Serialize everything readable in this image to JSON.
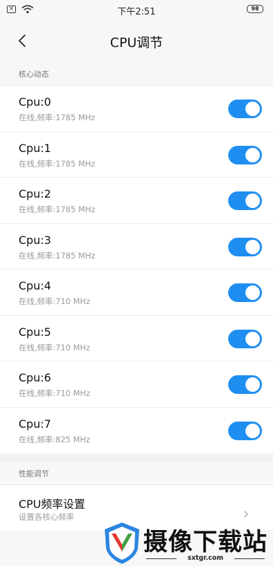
{
  "status_bar": {
    "time": "下午2:51",
    "battery": "98",
    "left_icons": [
      "sim-x-icon",
      "wifi-icon"
    ]
  },
  "header": {
    "title": "CPU调节",
    "back_icon": "chevron-left-icon"
  },
  "sections": {
    "core_state": {
      "label": "核心动态"
    },
    "perf": {
      "label": "性能调节"
    }
  },
  "cores": [
    {
      "title": "Cpu:0",
      "subtitle": "在线,频率:1785 MHz",
      "enabled": true
    },
    {
      "title": "Cpu:1",
      "subtitle": "在线,频率:1785 MHz",
      "enabled": true
    },
    {
      "title": "Cpu:2",
      "subtitle": "在线,频率:1785 MHz",
      "enabled": true
    },
    {
      "title": "Cpu:3",
      "subtitle": "在线,频率:1785 MHz",
      "enabled": true
    },
    {
      "title": "Cpu:4",
      "subtitle": "在线,频率:710 MHz",
      "enabled": true
    },
    {
      "title": "Cpu:5",
      "subtitle": "在线,频率:710 MHz",
      "enabled": true
    },
    {
      "title": "Cpu:6",
      "subtitle": "在线,频率:710 MHz",
      "enabled": true
    },
    {
      "title": "Cpu:7",
      "subtitle": "在线,频率:825 MHz",
      "enabled": true
    }
  ],
  "freq_setting": {
    "title": "CPU频率设置",
    "subtitle": "设置各核心频率"
  },
  "watermark": {
    "text": "摄像下载站",
    "domain": "sxtgr.com"
  },
  "colors": {
    "toggle_on": "#1f8ef1",
    "background_gray": "#f7f7f7"
  }
}
